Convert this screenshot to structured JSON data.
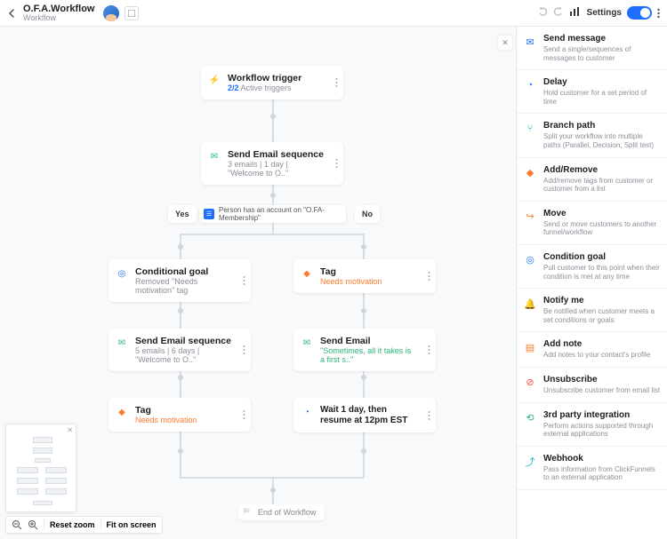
{
  "header": {
    "title": "O.F.A.Workflow",
    "subtitle": "Workflow",
    "settings": "Settings"
  },
  "decision": {
    "yes": "Yes",
    "no": "No",
    "condition_text": "Person has an account on \"O.FA-Membership\""
  },
  "nodes": {
    "trigger": {
      "title": "Workflow trigger",
      "active": "2/2",
      "active_suffix": " Active triggers"
    },
    "seq1": {
      "title": "Send Email sequence",
      "sub": "3 emails | 1 day | \"Welcome to O..\""
    },
    "condgoal": {
      "title": "Conditional goal",
      "sub": "Removed \"Needs motivation\" tag"
    },
    "tag1": {
      "title": "Tag",
      "sub": "Needs motivation"
    },
    "seq2": {
      "title": "Send Email sequence",
      "sub": "5 emails | 6 days | \"Welcome to O..\""
    },
    "email": {
      "title": "Send Email",
      "sub": "\"Sometimes, all it takes is a first s..\""
    },
    "tag2": {
      "title": "Tag",
      "sub": "Needs motivation"
    },
    "wait": {
      "title": "Wait 1 day, then resume at 12pm EST",
      "sub": ""
    },
    "end": "End of Workflow"
  },
  "sidebar": [
    {
      "icon": "send",
      "color": "ic-blue",
      "title": "Send message",
      "desc": "Send a single/sequences of messages to customer"
    },
    {
      "icon": "delay",
      "color": "ic-blue",
      "title": "Delay",
      "desc": "Hold customer for a set period of time"
    },
    {
      "icon": "branch",
      "color": "ic-teal",
      "title": "Branch path",
      "desc": "Split your workflow into multiple paths (Parallel, Decision, Split test)"
    },
    {
      "icon": "tag",
      "color": "ic-orange",
      "title": "Add/Remove",
      "desc": "Add/remove tags from customer or customer from a list"
    },
    {
      "icon": "move",
      "color": "ic-orange",
      "title": "Move",
      "desc": "Send or move customers to another funnel/workflow"
    },
    {
      "icon": "goal",
      "color": "ic-blue",
      "title": "Condition goal",
      "desc": "Pull customer to this point when their condition is met at any time"
    },
    {
      "icon": "bell",
      "color": "ic-purple",
      "title": "Notify me",
      "desc": "Be notified when customer meets a set conditions or goals"
    },
    {
      "icon": "note",
      "color": "ic-orange",
      "title": "Add note",
      "desc": "Add notes to your contact's profile"
    },
    {
      "icon": "unsub",
      "color": "ic-red",
      "title": "Unsubscribe",
      "desc": "Unsubscribe customer from email list"
    },
    {
      "icon": "plug",
      "color": "ic-green",
      "title": "3rd party integration",
      "desc": "Perform actions supported through external applications"
    },
    {
      "icon": "hook",
      "color": "ic-teal",
      "title": "Webhook",
      "desc": "Pass information from ClickFunnels to an external application"
    }
  ],
  "footer": {
    "reset": "Reset zoom",
    "fit": "Fit on screen"
  }
}
